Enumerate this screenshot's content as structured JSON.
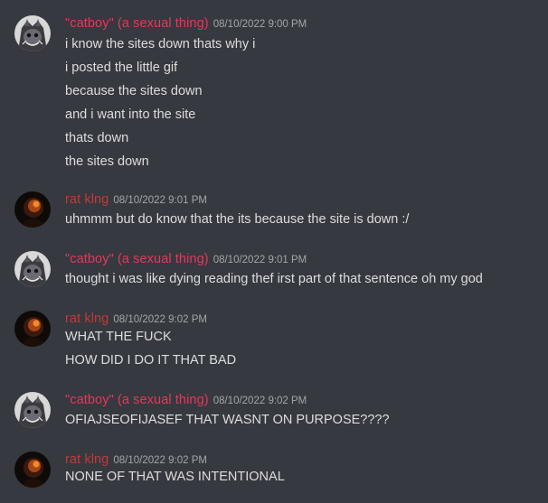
{
  "colors": {
    "background": "#36393f",
    "catboy_name": "#e6375c",
    "rat_name": "#c03a3a",
    "text": "#dcddde",
    "timestamp": "#a3a6aa"
  },
  "messages": [
    {
      "author": "\"catboy\" (a sexual thing)",
      "timestamp": "08/10/2022 9:00 PM",
      "avatar": "catboy-avatar",
      "lines": [
        "i know the sites down thats why i",
        "i posted the little gif",
        "because the sites down",
        "and i want into the site",
        "thats down",
        "the sites down"
      ]
    },
    {
      "author": "rat klng",
      "timestamp": "08/10/2022 9:01 PM",
      "avatar": "rat-avatar",
      "lines": [
        "uhmmm but do know that the its because the site is down :/"
      ]
    },
    {
      "author": "\"catboy\" (a sexual thing)",
      "timestamp": "08/10/2022 9:01 PM",
      "avatar": "catboy-avatar",
      "lines": [
        "thought i was like dying reading thef irst part of that sentence oh my god"
      ]
    },
    {
      "author": "rat klng",
      "timestamp": "08/10/2022 9:02 PM",
      "avatar": "rat-avatar",
      "lines": [
        "WHAT THE FUCK",
        "HOW DID I DO IT THAT BAD"
      ]
    },
    {
      "author": "\"catboy\" (a sexual thing)",
      "timestamp": "08/10/2022 9:02 PM",
      "avatar": "catboy-avatar",
      "lines": [
        "OFIAJSEOFIJASEF THAT WASNT ON PURPOSE????"
      ]
    },
    {
      "author": "rat klng",
      "timestamp": "08/10/2022 9:02 PM",
      "avatar": "rat-avatar",
      "lines": [
        "NONE OF THAT WAS INTENTIONAL"
      ]
    }
  ]
}
